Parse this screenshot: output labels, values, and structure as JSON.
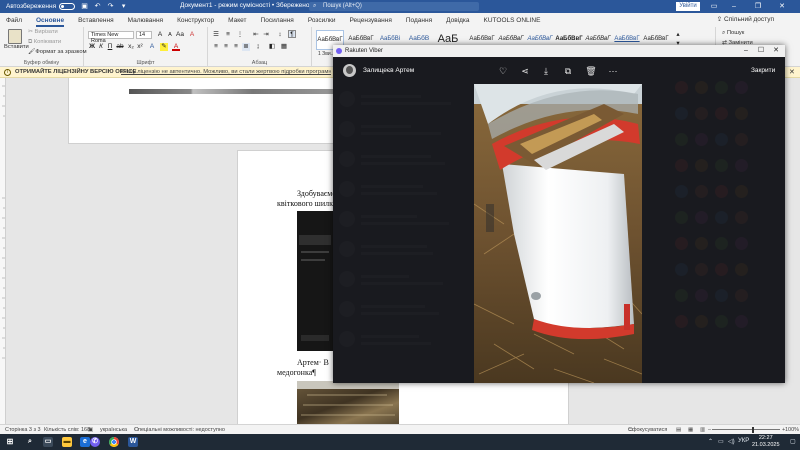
{
  "word": {
    "titlebar": {
      "autosave": "Автозбереження",
      "toggle_state": "Вимк",
      "doc_title": "Документ1 - режим сумісності • Збережено у цей ПК",
      "search_placeholder": "Пошук (Alt+Q)",
      "signin": "Увійти"
    },
    "ribbon_tabs": [
      "Файл",
      "Основне",
      "Вставлення",
      "Малювання",
      "Конструктор",
      "Макет",
      "Посилання",
      "Розсилки",
      "Рецензування",
      "Подання",
      "Довідка",
      "KUTOOLS ONLINE"
    ],
    "active_tab": "Основне",
    "share": "Спільний доступ",
    "clipboard": {
      "paste": "Вставити",
      "cut": "Вирізати",
      "copy": "Копіювати",
      "format_painter": "Формат за зразком",
      "label": "Буфер обміну"
    },
    "font": {
      "name": "Times New Roma",
      "size": "14",
      "label": "Шрифт"
    },
    "paragraph": {
      "label": "Абзац"
    },
    "styles": [
      "АаБбВвГ",
      "АаБбВвГ",
      "АаБбВі",
      "АаБбВ",
      "АаБ",
      "АаБбВвГ",
      "АаБбВвГ",
      "АаБбВвГ",
      "АаБбВвГ",
      "АаБбВвГ",
      "АаБбВвГ",
      "АаБбВвГ"
    ],
    "styles_first_label": "1 Зви...",
    "editing": {
      "find": "Пошук",
      "replace": "Замінити"
    },
    "infobar": {
      "bold_text": "ОТРИМАЙТЕ ЛІЦЕНЗІЙНУ ВЕРСІЮ OFFICE",
      "message": "Вашу ліцензію не автентично. Можливо, ви стали жертвою підробки програмного забезпечення."
    },
    "document": {
      "line1a": "Здобуваємо",
      "line1b": "квіткового шилку",
      "line2a": "Артем·  В",
      "line2b": "медогонка¶"
    },
    "statusbar": {
      "page": "Сторінка 3 з 3",
      "words": "Кількість слів: 168",
      "language": "українська",
      "accessibility": "Спеціальні можливості: недоступно",
      "focus": "Сфокусуватися",
      "zoom": "100%"
    }
  },
  "viber": {
    "window_title": "Rakuten Viber",
    "sender": "Залищеєв Артем",
    "close_label": "Закрити",
    "actions": [
      "heart-icon",
      "share-icon",
      "download-icon",
      "forward-icon",
      "trash-icon",
      "more-icon"
    ]
  },
  "taskbar": {
    "search": "Пошук",
    "language": "УКР",
    "time": "22:27",
    "date": "21.03.2025"
  },
  "colors": {
    "word_blue": "#2b579a",
    "viber_purple": "#7360f2",
    "infobar_bg": "#fff4ce"
  }
}
